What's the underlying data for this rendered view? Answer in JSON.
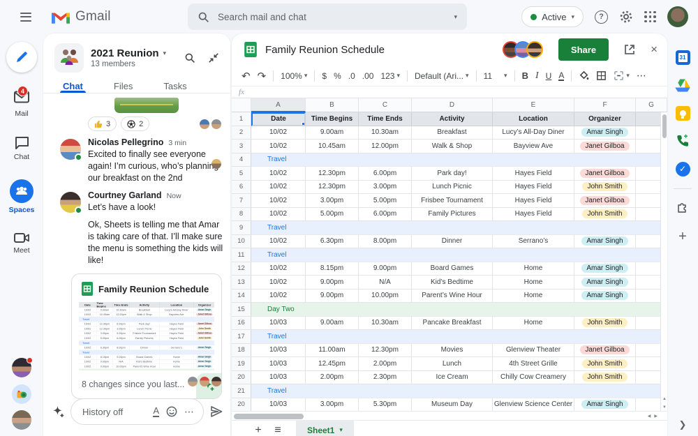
{
  "topbar": {
    "product": "Gmail",
    "search_placeholder": "Search mail and chat",
    "status_label": "Active"
  },
  "left_nav": {
    "items": [
      {
        "label": "Mail",
        "badge": "4"
      },
      {
        "label": "Chat"
      },
      {
        "label": "Spaces"
      },
      {
        "label": "Meet"
      }
    ]
  },
  "chat": {
    "title": "2021 Reunion",
    "members": "13 members",
    "tabs": [
      {
        "label": "Chat"
      },
      {
        "label": "Files"
      },
      {
        "label": "Tasks"
      }
    ],
    "reactions": [
      {
        "icon": "thumbs-up",
        "count": "3"
      },
      {
        "icon": "soccer-ball",
        "count": "2"
      }
    ],
    "messages": [
      {
        "sender": "Nicolas Pellegrino",
        "time": "3 min",
        "text": "Excited to finally see everyone again! I’m curious, who’s planning our breakfast on the 2nd"
      },
      {
        "sender": "Courtney Garland",
        "time": "Now",
        "text": "Let’s have a look!",
        "followup": "Ok, Sheets is telling me that Amar is taking care of that. I’ll make sure the menu is something the kids will like!"
      }
    ],
    "card": {
      "title": "Family Reunion Schedule",
      "footer": "8 changes since you last..."
    },
    "composer": {
      "placeholder": "History off"
    }
  },
  "sheet": {
    "title": "Family Reunion Schedule",
    "share_label": "Share",
    "toolbar": {
      "zoom": "100%",
      "currency": "$",
      "percent": "%",
      "dec0": ".0",
      "dec00": ".00",
      "format": "123",
      "font": "Default (Ari...",
      "font_size": "11",
      "bold": "B",
      "italic": "I",
      "underline": "U",
      "text_color": "A"
    },
    "formula_prefix": "fx",
    "columns": [
      "A",
      "B",
      "C",
      "D",
      "E",
      "F",
      "G"
    ],
    "organizer_colors": {
      "Amar Singh": "#cdeef3",
      "Janet Gilboa": "#fad9d6",
      "John Smith": "#fcefc3"
    },
    "rows": [
      {
        "n": "1",
        "kind": "header",
        "cells": [
          "Date",
          "Time Begins",
          "Time Ends",
          "Activity",
          "Location",
          "Organizer"
        ]
      },
      {
        "n": "2",
        "kind": "data",
        "cells": [
          "10/02",
          "9.00am",
          "10.30am",
          "Breakfast",
          "Lucy’s All-Day Diner",
          "Amar Singh"
        ]
      },
      {
        "n": "3",
        "kind": "data",
        "cells": [
          "10/02",
          "10.45am",
          "12.00pm",
          "Walk & Shop",
          "Bayview Ave",
          "Janet Gilboa"
        ]
      },
      {
        "n": "4",
        "kind": "travel",
        "label": "Travel"
      },
      {
        "n": "5",
        "kind": "data",
        "cells": [
          "10/02",
          "12.30pm",
          "6.00pm",
          "Park day!",
          "Hayes Field",
          "Janet Gilboa"
        ]
      },
      {
        "n": "6",
        "kind": "data",
        "cells": [
          "10/02",
          "12.30pm",
          "3.00pm",
          "Lunch Picnic",
          "Hayes Field",
          "John Smith"
        ]
      },
      {
        "n": "7",
        "kind": "data",
        "cells": [
          "10/02",
          "3.00pm",
          "5.00pm",
          "Frisbee Tournament",
          "Hayes Field",
          "Janet Gilboa"
        ]
      },
      {
        "n": "8",
        "kind": "data",
        "cells": [
          "10/02",
          "5.00pm",
          "6.00pm",
          "Family Pictures",
          "Hayes Field",
          "John Smith"
        ]
      },
      {
        "n": "9",
        "kind": "travel",
        "label": "Travel"
      },
      {
        "n": "10",
        "kind": "data",
        "cells": [
          "10/02",
          "6.30pm",
          "8.00pm",
          "Dinner",
          "Serrano’s",
          "Amar Singh"
        ]
      },
      {
        "n": "11",
        "kind": "travel",
        "label": "Travel"
      },
      {
        "n": "12",
        "kind": "data",
        "cells": [
          "10/02",
          "8.15pm",
          "9.00pm",
          "Board Games",
          "Home",
          "Amar Singh"
        ]
      },
      {
        "n": "13",
        "kind": "data",
        "cells": [
          "10/02",
          "9.00pm",
          "N/A",
          "Kid’s Bedtime",
          "Home",
          "Amar Singh"
        ]
      },
      {
        "n": "14",
        "kind": "data",
        "cells": [
          "10/02",
          "9.00pm",
          "10.00pm",
          "Parent’s Wine Hour",
          "Home",
          "Amar Singh"
        ]
      },
      {
        "n": "15",
        "kind": "day",
        "label": "Day Two"
      },
      {
        "n": "16",
        "kind": "data",
        "cells": [
          "10/03",
          "9.00am",
          "10.30am",
          "Pancake Breakfast",
          "Home",
          "John Smith"
        ]
      },
      {
        "n": "17",
        "kind": "travel",
        "label": "Travel"
      },
      {
        "n": "18",
        "kind": "data",
        "cells": [
          "10/03",
          "11.00am",
          "12.30pm",
          "Movies",
          "Glenview Theater",
          "Janet Gilboa"
        ]
      },
      {
        "n": "19",
        "kind": "data",
        "cells": [
          "10/03",
          "12.45pm",
          "2.00pm",
          "Lunch",
          "4th Street Grille",
          "John Smith"
        ]
      },
      {
        "n": "20",
        "kind": "data",
        "cells": [
          "10/03",
          "2.00pm",
          "2.30pm",
          "Ice Cream",
          "Chilly Cow Creamery",
          "John Smith"
        ]
      },
      {
        "n": "21",
        "kind": "travel",
        "label": "Travel"
      },
      {
        "n": "20",
        "kind": "data",
        "cells": [
          "10/03",
          "3.00pm",
          "5.30pm",
          "Museum Day",
          "Glenview Science Center",
          "Amar Singh"
        ]
      }
    ],
    "footer": {
      "tab_name": "Sheet1"
    }
  },
  "side_panel": {
    "icons": [
      "calendar",
      "drive",
      "keep",
      "voice",
      "tasks",
      "get-add-ons",
      "add"
    ],
    "calendar_day": "31",
    "tasks_check": "✓"
  },
  "colors": {
    "accent_blue": "#1a73e8",
    "active_green": "#1e8e3e",
    "share_green": "#188038",
    "badge_red": "#d93025",
    "travel_bg": "#e8f0fe",
    "day_bg": "#e6f4ea"
  }
}
